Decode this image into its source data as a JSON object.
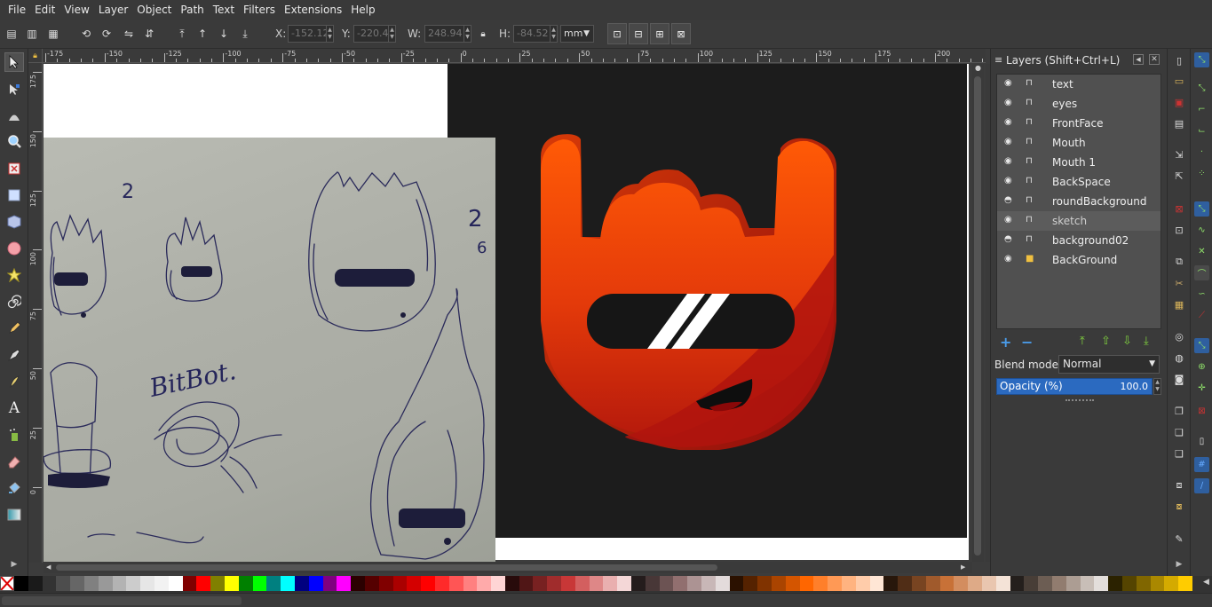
{
  "menu": [
    "File",
    "Edit",
    "View",
    "Layer",
    "Object",
    "Path",
    "Text",
    "Filters",
    "Extensions",
    "Help"
  ],
  "toolbar": {
    "x_label": "X:",
    "x_value": "-152.12",
    "y_label": "Y:",
    "y_value": "-220.4",
    "w_label": "W:",
    "w_value": "248.94",
    "h_label": "H:",
    "h_value": "-84.52",
    "unit": "mm"
  },
  "ruler_top": [
    "-175",
    "-150",
    "-125",
    "-100",
    "-75",
    "-50",
    "-25",
    "0",
    "25",
    "50",
    "75",
    "100",
    "125",
    "150",
    "175",
    "200"
  ],
  "ruler_left": [
    "175",
    "150",
    "125",
    "100",
    "75",
    "50",
    "25",
    "0"
  ],
  "canvas": {
    "sketch_text": "BitBot.",
    "sketch_num_a": "2",
    "sketch_num_b": "2",
    "sketch_num_c": "6"
  },
  "layers": {
    "title": "Layers (Shift+Ctrl+L)",
    "items": [
      {
        "name": "text",
        "visible": true,
        "locked": false
      },
      {
        "name": "eyes",
        "visible": true,
        "locked": false
      },
      {
        "name": "FrontFace",
        "visible": true,
        "locked": false
      },
      {
        "name": "Mouth",
        "visible": true,
        "locked": false
      },
      {
        "name": "Mouth 1",
        "visible": true,
        "locked": false
      },
      {
        "name": "BackSpace",
        "visible": true,
        "locked": false
      },
      {
        "name": "roundBackground",
        "visible": false,
        "locked": false
      },
      {
        "name": "sketch",
        "visible": true,
        "locked": false,
        "selected": true
      },
      {
        "name": "background02",
        "visible": false,
        "locked": false
      },
      {
        "name": "BackGround",
        "visible": true,
        "locked": true
      }
    ],
    "blend_label": "Blend mode:",
    "blend_value": "Normal",
    "opacity_label": "Opacity (%)",
    "opacity_value": "100.0"
  },
  "colors": {
    "accent": "#2b6ac0",
    "logo_orange": "#f25a08",
    "logo_red": "#c9200a",
    "dark_bg": "#1c1c1c"
  },
  "palette": [
    "#000000",
    "#1a1a1a",
    "#333333",
    "#4d4d4d",
    "#666666",
    "#808080",
    "#999999",
    "#b3b3b3",
    "#cccccc",
    "#e6e6e6",
    "#f2f2f2",
    "#ffffff",
    "#800000",
    "#ff0000",
    "#808000",
    "#ffff00",
    "#008000",
    "#00ff00",
    "#008080",
    "#00ffff",
    "#000080",
    "#0000ff",
    "#800080",
    "#ff00ff",
    "#2b0000",
    "#550000",
    "#800000",
    "#aa0000",
    "#d40000",
    "#ff0000",
    "#ff2a2a",
    "#ff5555",
    "#ff8080",
    "#ffaaaa",
    "#ffd5d5",
    "#280b0b",
    "#501616",
    "#782121",
    "#a02c2c",
    "#c83737",
    "#d35f5f",
    "#de8787",
    "#e9afaf",
    "#f4d7d7",
    "#241c1c",
    "#483737",
    "#6c5353",
    "#916f6f",
    "#ac9393",
    "#c8b7b7",
    "#e3dbdb",
    "#2b1100",
    "#552200",
    "#803300",
    "#aa4400",
    "#d45500",
    "#ff6600",
    "#ff7f2a",
    "#ff9955",
    "#ffb380",
    "#ffccaa",
    "#ffe6d5",
    "#28170b",
    "#502d16",
    "#784421",
    "#a05a2c",
    "#c87137",
    "#d38d5f",
    "#deaa87",
    "#e9c6af",
    "#f4e3d7",
    "#241f1c",
    "#483e37",
    "#6c5d53",
    "#917c6f",
    "#ac9d93",
    "#c8beb7",
    "#e3dedb",
    "#2b2200",
    "#554400",
    "#806600",
    "#aa8800",
    "#d4aa00",
    "#ffcc00"
  ]
}
